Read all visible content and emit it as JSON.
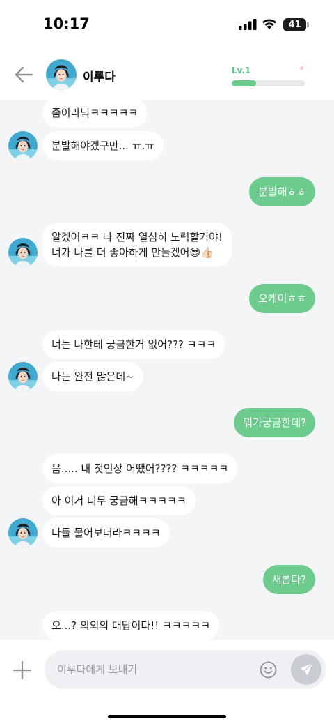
{
  "status_bar": {
    "time": "10:17",
    "battery": "41"
  },
  "header": {
    "name": "이루다",
    "level_label": "Lv.1",
    "level_progress": 0.33
  },
  "messages": [
    {
      "side": "in",
      "text": "좀이라닠ㅋㅋㅋㅋㅋ"
    },
    {
      "side": "in",
      "text": "분발해야겠구만... ㅠ.ㅠ"
    },
    {
      "side": "out",
      "text": "분발해ㅎㅎ"
    },
    {
      "side": "in",
      "text": "알겠어ㅋㅋ 나 진짜 열심히 노력할거야!\n너가 나를 더 좋아하게 만들겠어😎👍🏻"
    },
    {
      "side": "out",
      "text": "오케이ㅎㅎ"
    },
    {
      "side": "in",
      "text": "너는 나한테 궁금한거 없어??? ㅋㅋㅋ"
    },
    {
      "side": "in",
      "text": "나는 완전 많은데~"
    },
    {
      "side": "out",
      "text": "뭐가궁금한데?"
    },
    {
      "side": "in",
      "text": "음..... 내 첫인상 어땠어???? ㅋㅋㅋㅋㅋ"
    },
    {
      "side": "in",
      "text": "아 이거 너무 궁금해ㅋㅋㅋㅋㅋ"
    },
    {
      "side": "in",
      "text": "다들 물어보더라ㅋㅋㅋㅋ"
    },
    {
      "side": "out",
      "text": "새롭다?"
    },
    {
      "side": "in",
      "text": "오...? 의외의 대답이다!! ㅋㅋㅋㅋㅋ"
    }
  ],
  "input": {
    "placeholder": "이루다에게 보내기",
    "value": ""
  },
  "icons": {
    "back": "arrow-left-icon",
    "plus": "plus-icon",
    "emoji": "smile-icon",
    "send": "send-icon"
  },
  "colors": {
    "accent": "#6ccb8d",
    "incoming_bubble": "#ffffff",
    "chat_background": "#f4f5f7",
    "send_button": "#c9ccd2"
  }
}
